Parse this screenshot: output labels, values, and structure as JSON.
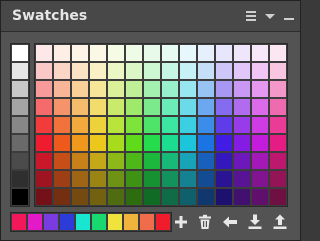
{
  "panel": {
    "title": "Swatches",
    "menu_icon": "hamburger-menu-icon",
    "dropdown_icon": "chevron-down-icon",
    "minimize_icon": "minimize-icon"
  },
  "grayscale": [
    "#ffffff",
    "#e6e6e6",
    "#c8c8c8",
    "#a5a5a5",
    "#878787",
    "#6a6a6a",
    "#4b4b4b",
    "#2f2f2f",
    "#000000"
  ],
  "grid": [
    [
      "#fde8e8",
      "#fdeee6",
      "#fdf3e6",
      "#fcf8e6",
      "#f6fbe6",
      "#eefbe6",
      "#e8fbea",
      "#e6fbf2",
      "#e6f8fb",
      "#e6f0fc",
      "#e8e6fc",
      "#f0e6fc",
      "#f8e6fb",
      "#fbe6f2"
    ],
    [
      "#fbc8c8",
      "#fbd6c6",
      "#fbe4c6",
      "#f9f0c6",
      "#ecf7c6",
      "#dcf7c6",
      "#cdf7d2",
      "#c6f7e4",
      "#c6f1f7",
      "#c6dff9",
      "#cec6f9",
      "#e0c6f9",
      "#f1c6f7",
      "#f9c6e2"
    ],
    [
      "#f89a9a",
      "#f8b598",
      "#f8d098",
      "#f6e698",
      "#dbf098",
      "#bff098",
      "#a4f0b0",
      "#98f0cd",
      "#98e6f0",
      "#98c4f4",
      "#a898f4",
      "#c898f4",
      "#e698f0",
      "#f498c9"
    ],
    [
      "#f56b6b",
      "#f5946b",
      "#f5bd6b",
      "#f2dc6b",
      "#c9ea6b",
      "#9fea6b",
      "#7aea8d",
      "#6bebb8",
      "#6bdbea",
      "#6ba8ef",
      "#846bef",
      "#b06bef",
      "#db6bea",
      "#ef6bb0"
    ],
    [
      "#f23c3c",
      "#f2723c",
      "#f2aa3c",
      "#eed23c",
      "#b8e43c",
      "#7ee43c",
      "#4ee46a",
      "#3ce5a2",
      "#3ccfe4",
      "#3c8cea",
      "#5f3cea",
      "#983cea",
      "#cf3ce4",
      "#ea3c97"
    ],
    [
      "#ee1c2e",
      "#ee5a1c",
      "#f0981c",
      "#ecc81c",
      "#a6dc1c",
      "#5edc1c",
      "#24dc4c",
      "#1cdc90",
      "#1cc4dc",
      "#1c74e4",
      "#401ce4",
      "#841ce4",
      "#c41cdc",
      "#e41c84"
    ],
    [
      "#c8182a",
      "#c84e18",
      "#c88018",
      "#c4a818",
      "#8cb818",
      "#4eb818",
      "#1cb83e",
      "#18b878",
      "#18a4b8",
      "#1860bc",
      "#3418bc",
      "#6e18bc",
      "#a418b8",
      "#bc186e"
    ],
    [
      "#9e1420",
      "#9e3e14",
      "#9e6614",
      "#9a8414",
      "#6e9214",
      "#3e9214",
      "#169232",
      "#14925e",
      "#148292",
      "#144c94",
      "#2a1494",
      "#581494",
      "#821492",
      "#941458"
    ],
    [
      "#741018",
      "#742e10",
      "#744a10",
      "#726210",
      "#506c10",
      "#2e6c10",
      "#106c24",
      "#106c46",
      "#10606c",
      "#10386e",
      "#1e106e",
      "#42106e",
      "#60106c",
      "#6e1042"
    ]
  ],
  "recent": [
    "#f2185a",
    "#e21ac8",
    "#7a3ce0",
    "#2d3cd8",
    "#18e6d0",
    "#1ad870",
    "#f0e43c",
    "#f0b43c",
    "#f06c4a",
    "#f01c2c"
  ],
  "toolbar": [
    {
      "name": "add-swatch-button",
      "icon": "plus-icon"
    },
    {
      "name": "delete-swatch-button",
      "icon": "trash-icon"
    },
    {
      "name": "load-swatches-button",
      "icon": "arrow-left-icon"
    },
    {
      "name": "import-swatches-button",
      "icon": "download-icon"
    },
    {
      "name": "export-swatches-button",
      "icon": "upload-icon"
    }
  ]
}
